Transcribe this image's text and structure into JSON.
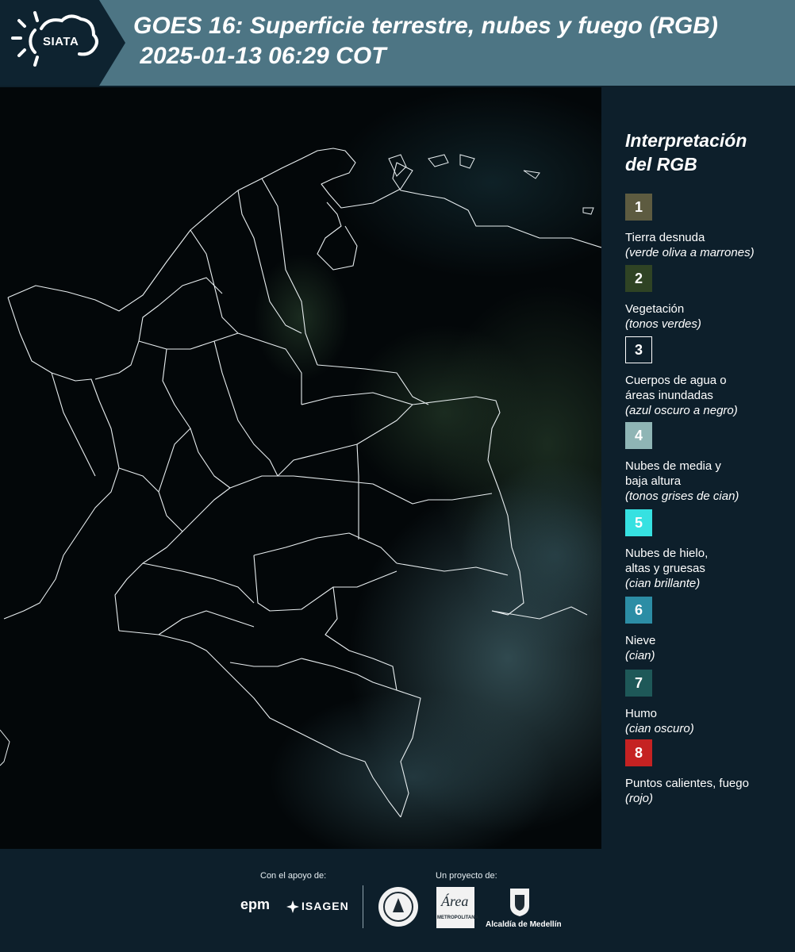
{
  "header": {
    "logo_text": "SIATA",
    "title_line1": "GOES 16: Superficie terrestre, nubes y fuego (RGB)",
    "title_line2": " 2025-01-13 06:29 COT"
  },
  "legend": {
    "title_line1": "Interpretación",
    "title_line2": "del RGB",
    "items": [
      {
        "num": "1",
        "desc1": "Tierra desnuda",
        "desc2": "",
        "sub": "(verde oliva a marrones)",
        "color": "#5d5b40"
      },
      {
        "num": "2",
        "desc1": "Vegetación",
        "desc2": "",
        "sub": "(tonos verdes)",
        "color": "#2f4324"
      },
      {
        "num": "3",
        "desc1": "Cuerpos de agua o",
        "desc2": "áreas inundadas",
        "sub": "(azul oscuro a negro)",
        "color": "#0d1f2b"
      },
      {
        "num": "4",
        "desc1": "Nubes de media y",
        "desc2": "baja altura",
        "sub": "(tonos grises de cian)",
        "color": "#8fb5b5"
      },
      {
        "num": "5",
        "desc1": "Nubes de hielo,",
        "desc2": "altas y gruesas",
        "sub": "(cian brillante)",
        "color": "#36e1e1"
      },
      {
        "num": "6",
        "desc1": "Nieve",
        "desc2": "",
        "sub": "(cian)",
        "color": "#2c8da5"
      },
      {
        "num": "7",
        "desc1": "Humo",
        "desc2": "",
        "sub": "(cian oscuro)",
        "color": "#1e5858"
      },
      {
        "num": "8",
        "desc1": "Puntos calientes, fuego",
        "desc2": "",
        "sub": "(rojo)",
        "color": "#c52222"
      }
    ]
  },
  "footer": {
    "support_label": "Con el apoyo de:",
    "project_label": "Un proyecto de:",
    "epm": "epm",
    "isagen": "ISAGEN",
    "area_name": "Área",
    "area_sub": "METROPOLITANA",
    "alcaldia": "Alcaldía de Medellín"
  }
}
